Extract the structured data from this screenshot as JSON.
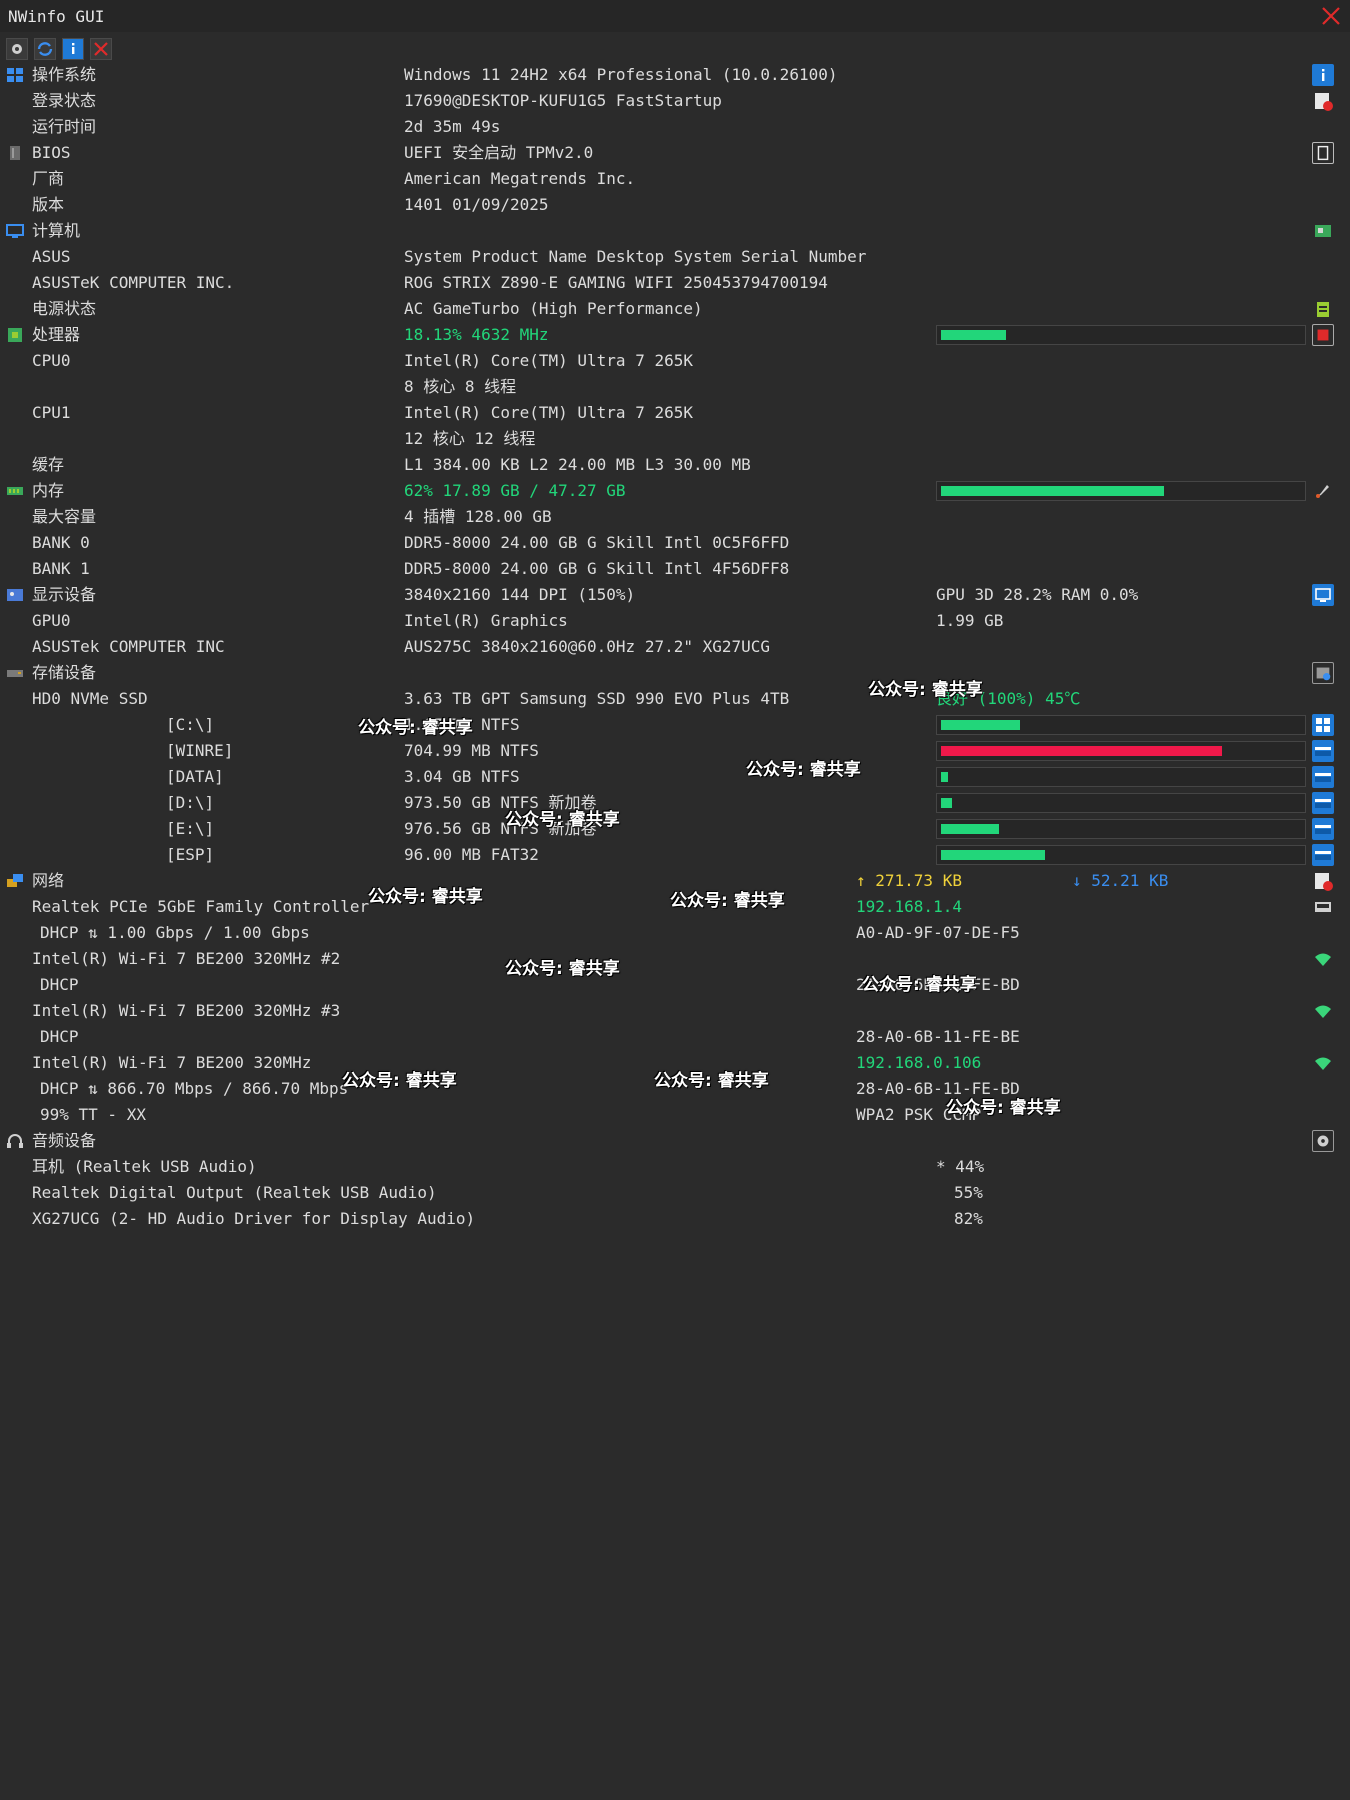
{
  "window": {
    "title": "NWinfo GUI"
  },
  "colors": {
    "green": "#22d67a",
    "red": "#f0194a",
    "blue": "#3a8ef0",
    "yellow": "#f0d23a",
    "background": "#2b2b2b"
  },
  "os": {
    "label": "操作系统",
    "value": "Windows 11 24H2 x64 Professional (10.0.26100)",
    "login_label": "登录状态",
    "login_value": "17690@DESKTOP-KUFU1G5 FastStartup",
    "uptime_label": "运行时间",
    "uptime_value": "2d 35m 49s"
  },
  "bios": {
    "label": "BIOS",
    "value": "UEFI 安全启动 TPMv2.0",
    "vendor_label": "厂商",
    "vendor_value": "American Megatrends Inc.",
    "version_label": "版本",
    "version_value": "1401 01/09/2025"
  },
  "computer": {
    "label": "计算机",
    "maker_label": "ASUS",
    "maker_value": "System Product Name Desktop System Serial Number",
    "board_label": "ASUSTeK COMPUTER INC.",
    "board_value": "ROG STRIX Z890-E GAMING WIFI 250453794700194",
    "power_label": "电源状态",
    "power_value": "AC  GameTurbo (High Performance)"
  },
  "cpu": {
    "label": "处理器",
    "usage_text": "18.13% 4632 MHz",
    "usage_fraction": 0.18,
    "cpu0_label": "CPU0",
    "cpu0_name": "Intel(R) Core(TM) Ultra 7 265K",
    "cpu0_cores": "8 核心 8 线程",
    "cpu1_label": "CPU1",
    "cpu1_name": "Intel(R) Core(TM) Ultra 7 265K",
    "cpu1_cores": "12 核心 12 线程",
    "cache_label": "缓存",
    "cache_value": "L1 384.00 KB L2 24.00 MB L3 30.00 MB"
  },
  "memory": {
    "label": "内存",
    "usage_text": "62% 17.89 GB / 47.27 GB",
    "usage_fraction": 0.62,
    "max_label": "最大容量",
    "max_value": "4 插槽 128.00 GB",
    "bank0_label": "BANK 0",
    "bank0_value": "DDR5-8000 24.00 GB G Skill Intl 0C5F6FFD",
    "bank1_label": "BANK 1",
    "bank1_value": "DDR5-8000 24.00 GB G Skill Intl 4F56DFF8"
  },
  "display": {
    "label": "显示设备",
    "value": "3840x2160 144 DPI (150%)",
    "gpu_usage": "GPU 3D 28.2% RAM 0.0%",
    "gpu0_label": "GPU0",
    "gpu0_value": "Intel(R) Graphics",
    "gpu0_mem": "1.99 GB",
    "monitor_label": "ASUSTek COMPUTER INC",
    "monitor_value": "AUS275C 3840x2160@60.0Hz 27.2\" XG27UCG"
  },
  "storage": {
    "label": "存储设备",
    "disk_label": "HD0 NVMe SSD",
    "disk_value": "3.63 TB GPT Samsung SSD 990 EVO Plus 4TB",
    "disk_health": "良好 (100%) 45℃",
    "volumes": [
      {
        "name": "[C:\\]",
        "value": "1.67 TB NTFS",
        "fraction": 0.22,
        "color": "#22d67a"
      },
      {
        "name": "[WINRE]",
        "value": "704.99 MB NTFS",
        "fraction": 0.78,
        "color": "#f0194a"
      },
      {
        "name": "[DATA]",
        "value": "3.04 GB NTFS",
        "fraction": 0.02,
        "color": "#22d67a"
      },
      {
        "name": "[D:\\]",
        "value": "973.50 GB NTFS 新加卷",
        "fraction": 0.03,
        "color": "#22d67a"
      },
      {
        "name": "[E:\\]",
        "value": "976.56 GB NTFS 新加卷",
        "fraction": 0.16,
        "color": "#22d67a"
      },
      {
        "name": "[ESP]",
        "value": "96.00 MB FAT32",
        "fraction": 0.29,
        "color": "#22d67a"
      }
    ]
  },
  "network": {
    "label": "网络",
    "upload": "↑ 271.73 KB",
    "download": "↓ 52.21 KB",
    "eth_label": "Realtek PCIe 5GbE Family Controller",
    "eth_ip": "192.168.1.4",
    "eth_dhcp": "DHCP ⇅ 1.00 Gbps / 1.00 Gbps",
    "eth_mac": "A0-AD-9F-07-DE-F5",
    "wifi2_label": "Intel(R) Wi-Fi 7 BE200 320MHz #2",
    "wifi2_dhcp": "DHCP",
    "wifi2_mac": "2A-A0-6B-11-FE-BD",
    "wifi3_label": "Intel(R) Wi-Fi 7 BE200 320MHz #3",
    "wifi3_dhcp": "DHCP",
    "wifi3_mac": "28-A0-6B-11-FE-BE",
    "wifi_label": "Intel(R) Wi-Fi 7 BE200 320MHz",
    "wifi_ip": "192.168.0.106",
    "wifi_dhcp": "DHCP ⇅ 866.70 Mbps / 866.70 Mbps",
    "wifi_mac": "28-A0-6B-11-FE-BD",
    "wifi_ssid": "99% TT - XX",
    "wifi_security": "WPA2 PSK CCMP"
  },
  "audio": {
    "label": "音频设备",
    "devices": [
      {
        "name": "耳机 (Realtek USB Audio)",
        "volume": "* 44%"
      },
      {
        "name": "Realtek Digital Output (Realtek USB Audio)",
        "volume": "55%"
      },
      {
        "name": "XG27UCG (2- HD Audio Driver for Display Audio)",
        "volume": "82%"
      }
    ]
  },
  "watermark": "公众号: 睿共享"
}
